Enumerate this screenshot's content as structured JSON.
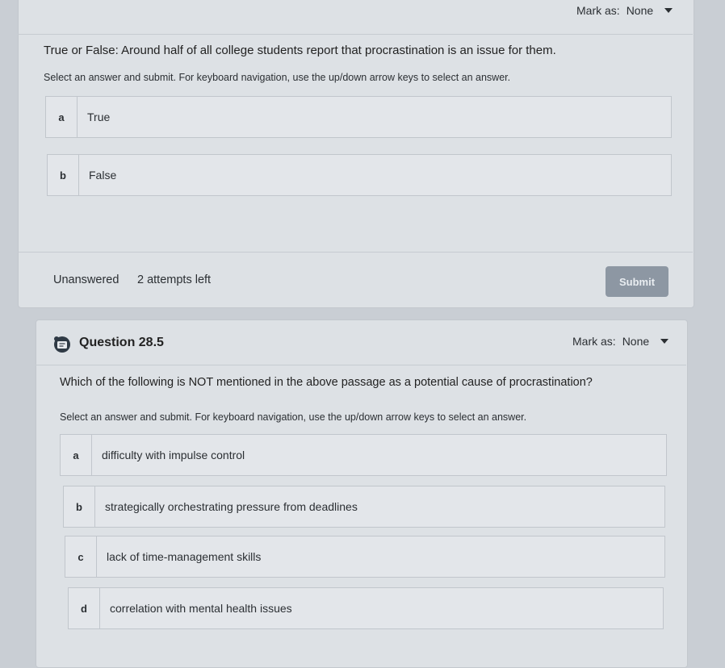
{
  "question1": {
    "mark_as_label": "Mark as:",
    "mark_as_value": "None",
    "text": "True or False: Around half of all college students report that procrastination is an issue for them.",
    "instructions": "Select an answer and submit. For keyboard navigation, use the up/down arrow keys to select an answer.",
    "options": [
      {
        "letter": "a",
        "text": "True"
      },
      {
        "letter": "b",
        "text": "False"
      }
    ],
    "status": "Unanswered",
    "attempts": "2 attempts left",
    "submit_label": "Submit"
  },
  "question2": {
    "title": "Question 28.5",
    "mark_as_label": "Mark as:",
    "mark_as_value": "None",
    "text": "Which of the following is NOT mentioned in the above passage as a potential cause of procrastination?",
    "instructions": "Select an answer and submit. For keyboard navigation, use the up/down arrow keys to select an answer.",
    "options": [
      {
        "letter": "a",
        "text": "difficulty with impulse control"
      },
      {
        "letter": "b",
        "text": "strategically orchestrating pressure from deadlines"
      },
      {
        "letter": "c",
        "text": "lack of time-management skills"
      },
      {
        "letter": "d",
        "text": "correlation with mental health issues"
      }
    ]
  },
  "icons": {
    "question_icon": "quiz-question-icon",
    "dropdown_icon": "chevron-down-icon"
  },
  "colors": {
    "background": "#c9ced4",
    "card": "#dde1e5",
    "submit_button": "#8d97a3"
  }
}
